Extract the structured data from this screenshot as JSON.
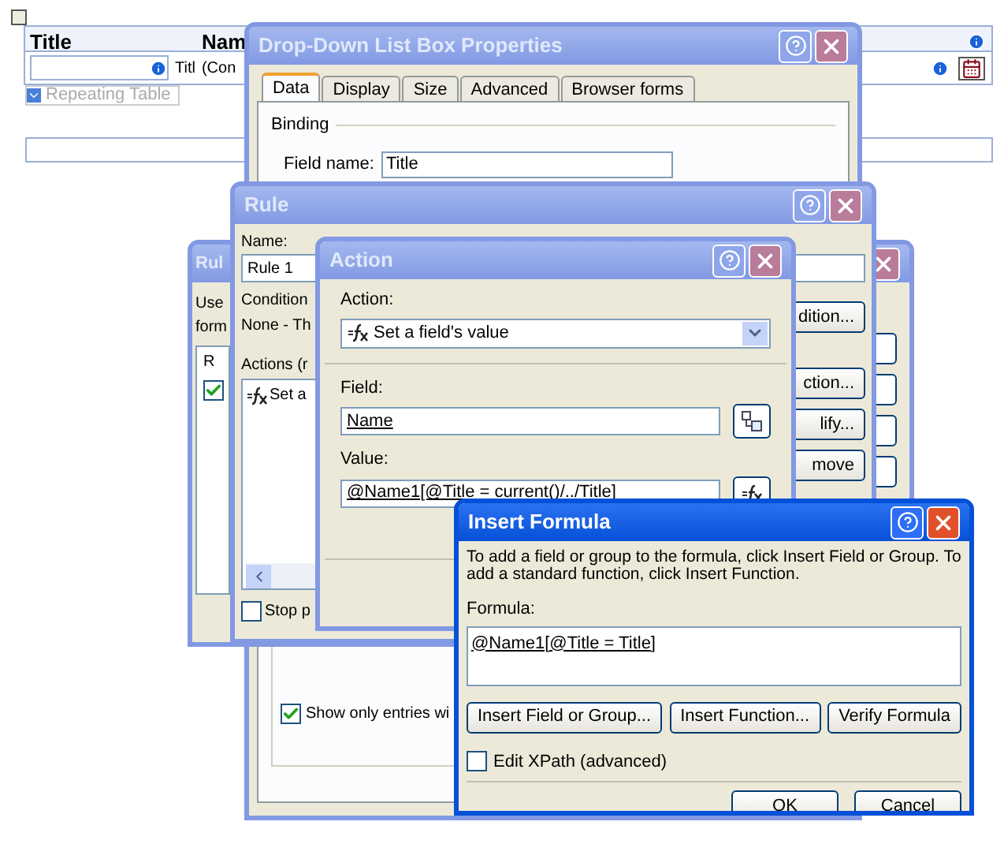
{
  "form": {
    "headers": [
      "Title",
      "Nam"
    ],
    "cell_values": [
      "Titl",
      "(Con"
    ],
    "table_label": "Repeating Table"
  },
  "drop_down_properties": {
    "title": "Drop-Down List Box Properties",
    "active": false,
    "tabs": [
      {
        "label": "Data",
        "selected": true
      },
      {
        "label": "Display",
        "selected": false
      },
      {
        "label": "Size",
        "selected": false
      },
      {
        "label": "Advanced",
        "selected": false
      },
      {
        "label": "Browser forms",
        "selected": false
      }
    ],
    "binding_label": "Binding",
    "field_name_label": "Field name:",
    "field_name": "Title",
    "show_only_entries": {
      "label": "Show only entries wi",
      "checked": true
    }
  },
  "rules": {
    "title": "Rul",
    "active": false,
    "description": [
      "Use",
      "form"
    ],
    "column": "R",
    "row_checked": true
  },
  "rule": {
    "title": "Rule",
    "active": false,
    "name_label": "Name:",
    "name": "Rule 1",
    "condition_label": "Condition",
    "condition": "None - Th",
    "actions_label": "Actions (r",
    "actions": [
      "Set a"
    ],
    "stop": {
      "label": "Stop p",
      "checked": false
    },
    "buttons": [
      "dition...",
      "ction...",
      "lify...",
      "move"
    ]
  },
  "action": {
    "title": "Action",
    "active": false,
    "action_label": "Action:",
    "action_value": "Set a field's value",
    "field_label": "Field:",
    "field_value": "Name",
    "value_label": "Value:",
    "value": "@Name1[@Title = current()/../Title]"
  },
  "insert_formula": {
    "title": "Insert Formula",
    "active": true,
    "instructions": "To add a field or group to the formula, click Insert Field or Group. To add a standard function, click Insert Function.",
    "formula_label": "Formula:",
    "formula": "@Name1[@Title = Title]",
    "buttons": [
      "Insert Field or Group...",
      "Insert Function...",
      "Verify Formula"
    ],
    "edit_xpath": {
      "label": "Edit XPath (advanced)",
      "checked": false
    },
    "ok": "OK",
    "cancel": "Cancel"
  }
}
